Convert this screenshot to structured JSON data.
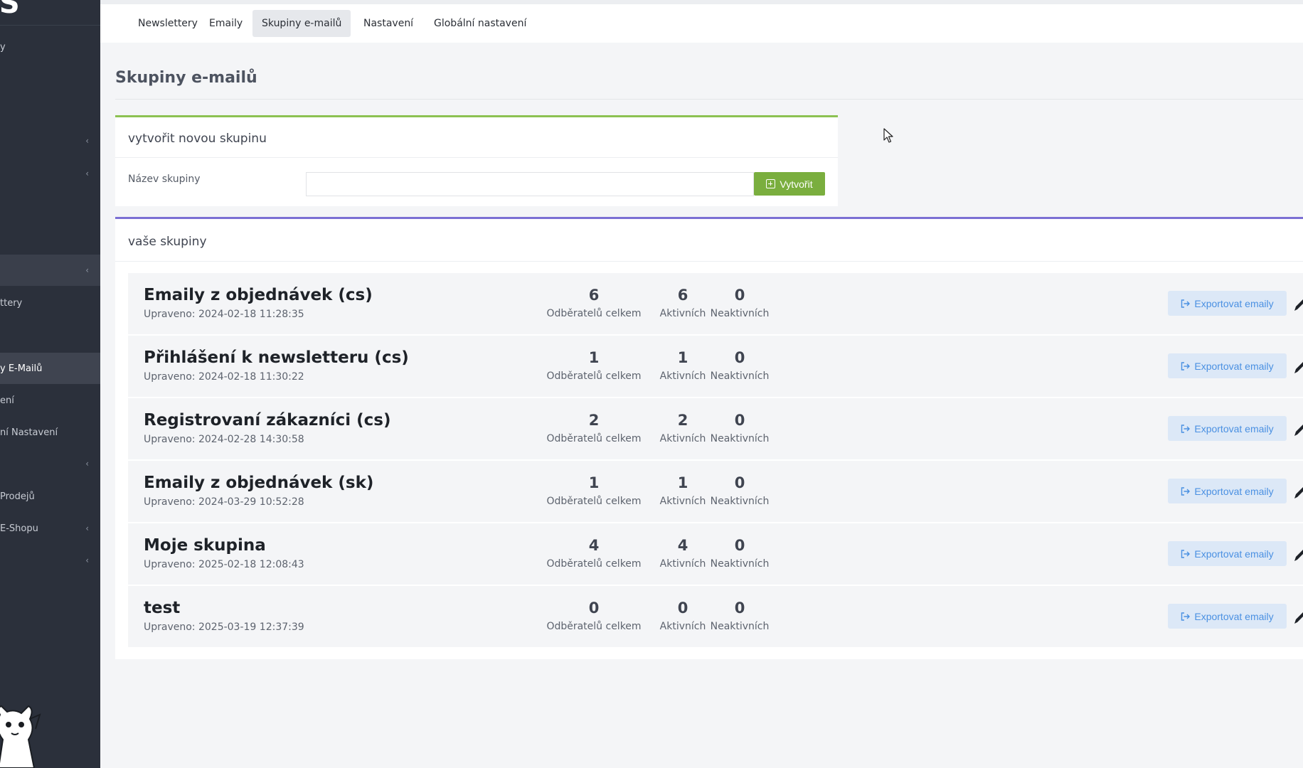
{
  "sidebar": {
    "logo_text": "IS",
    "items": [
      {
        "label": "y",
        "chevron": ""
      },
      {
        "label": "",
        "chevron": "‹"
      },
      {
        "label": "",
        "chevron": "‹"
      },
      {
        "label": "",
        "chevron": "‹"
      },
      {
        "label": "ttery",
        "chevron": ""
      },
      {
        "label": "y E-Mailů",
        "chevron": ""
      },
      {
        "label": "ení",
        "chevron": ""
      },
      {
        "label": "ní Nastavení",
        "chevron": ""
      },
      {
        "label": "",
        "chevron": "‹"
      },
      {
        "label": "Prodejů",
        "chevron": ""
      },
      {
        "label": "E-Shopu",
        "chevron": "‹"
      },
      {
        "label": "",
        "chevron": "‹"
      }
    ]
  },
  "tabs": [
    "Newslettery",
    "Emaily",
    "Skupiny e-mailů",
    "Nastavení",
    "Globální nastavení"
  ],
  "active_tab": "Skupiny e-mailů",
  "page_title": "Skupiny e-mailů",
  "create_card": {
    "title": "vytvořit novou skupinu",
    "label": "Název skupiny",
    "input_value": "",
    "button_label": "Vytvořit"
  },
  "groups_card": {
    "title": "vaše skupiny",
    "stat_captions": [
      "Odběratelů celkem",
      "Aktivních",
      "Neaktivních"
    ],
    "export_label": "Exportovat emaily",
    "rows": [
      {
        "name": "Emaily z objednávek (cs)",
        "updated": "Upraveno: 2024-02-18 11:28:35",
        "total": "6",
        "active": "6",
        "inactive": "0"
      },
      {
        "name": "Přihlášení k newsletteru (cs)",
        "updated": "Upraveno: 2024-02-18 11:30:22",
        "total": "1",
        "active": "1",
        "inactive": "0"
      },
      {
        "name": "Registrovaní zákazníci (cs)",
        "updated": "Upraveno: 2024-02-28 14:30:58",
        "total": "2",
        "active": "2",
        "inactive": "0"
      },
      {
        "name": "Emaily z objednávek (sk)",
        "updated": "Upraveno: 2024-03-29 10:52:28",
        "total": "1",
        "active": "1",
        "inactive": "0"
      },
      {
        "name": "Moje skupina",
        "updated": "Upraveno: 2025-02-18 12:08:43",
        "total": "4",
        "active": "4",
        "inactive": "0"
      },
      {
        "name": "test",
        "updated": "Upraveno: 2025-03-19 12:37:39",
        "total": "0",
        "active": "0",
        "inactive": "0"
      }
    ]
  },
  "colors": {
    "sidebar_bg": "#2b303b",
    "create_accent": "#8cc152",
    "groups_accent": "#7b6fd4",
    "create_button": "#7aae3e",
    "export_button_bg": "#dce8f7",
    "export_button_text": "#4a90e2"
  },
  "icons": [
    "plus-square-icon",
    "export-icon",
    "edit-icon",
    "chevron-left-icon",
    "mouse-cursor-icon",
    "mascot-icon"
  ]
}
